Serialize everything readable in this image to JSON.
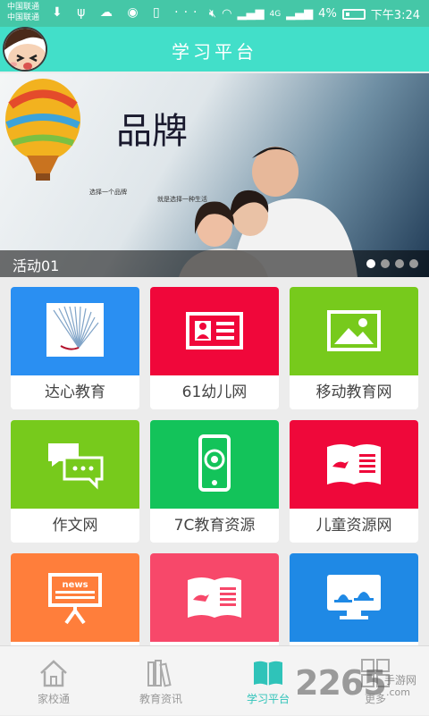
{
  "status_bar": {
    "carrier_1": "中国联通",
    "carrier_2": "中国联通",
    "left_glyphs": "⬇ ψ ☁ ◉ ▯ ···",
    "signal_text": "4G",
    "battery_pct": "4%",
    "time": "下午3:24"
  },
  "header": {
    "title": "学习平台"
  },
  "banner": {
    "caption": "活动01",
    "slide_count": 4,
    "active_slide": 1,
    "headline": "品牌",
    "tagline_1": "选择一个品牌",
    "tagline_2": "就是选择一种生活"
  },
  "tiles": [
    {
      "label": "达心教育",
      "color": "#2a8ff2",
      "icon": "book-fan-icon"
    },
    {
      "label": "61幼儿网",
      "color": "#f0073a",
      "icon": "id-card-icon"
    },
    {
      "label": "移动教育网",
      "color": "#77ca1c",
      "icon": "picture-icon"
    },
    {
      "label": "作文网",
      "color": "#77ca1c",
      "icon": "chat-bubbles-icon"
    },
    {
      "label": "7C教育资源",
      "color": "#13c35a",
      "icon": "phone-icon"
    },
    {
      "label": "儿童资源网",
      "color": "#ef083a",
      "icon": "open-book-icon"
    },
    {
      "label": "",
      "color": "#ff7e3b",
      "icon": "news-board-icon",
      "icon_text": "news"
    },
    {
      "label": "",
      "color": "#f7486a",
      "icon": "open-book-icon"
    },
    {
      "label": "",
      "color": "#1f89e5",
      "icon": "monitor-icon"
    }
  ],
  "tabbar": {
    "tabs": [
      {
        "label": "家校通",
        "icon": "house-icon",
        "active": false
      },
      {
        "label": "教育资讯",
        "icon": "books-icon",
        "active": false
      },
      {
        "label": "学习平台",
        "icon": "open-book-icon",
        "active": true
      },
      {
        "label": "更多",
        "icon": "grid-icon",
        "active": false
      }
    ],
    "active_color": "#2fc3b9",
    "inactive_color": "#999999"
  },
  "watermark": {
    "text": "2265",
    "sub": "手游网",
    "tld": ".com"
  }
}
